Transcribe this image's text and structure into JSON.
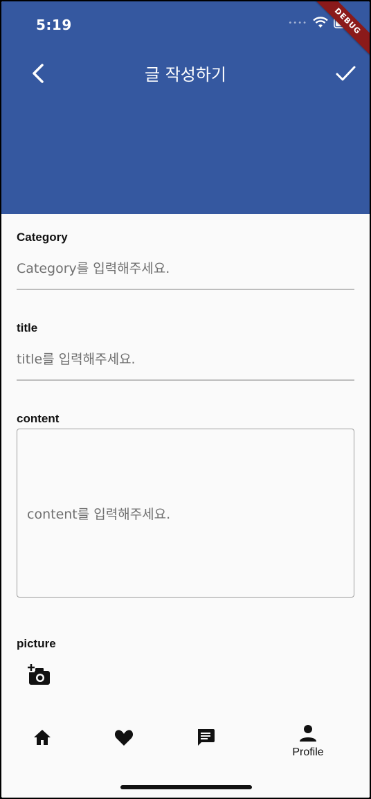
{
  "status_bar": {
    "time": "5:19",
    "debug_label": "DEBUG"
  },
  "app_bar": {
    "title": "글 작성하기",
    "back_icon": "chevron-left-icon",
    "confirm_icon": "check-icon"
  },
  "form": {
    "category": {
      "label": "Category",
      "placeholder": "Category를 입력해주세요."
    },
    "title": {
      "label": "title",
      "placeholder": "title를 입력해주세요."
    },
    "content": {
      "label": "content",
      "placeholder": "content를 입력해주세요."
    },
    "picture": {
      "label": "picture",
      "icon": "add-photo-icon"
    }
  },
  "bottom_nav": {
    "items": [
      {
        "icon": "home-icon",
        "label": ""
      },
      {
        "icon": "heart-icon",
        "label": ""
      },
      {
        "icon": "chat-icon",
        "label": ""
      },
      {
        "icon": "person-icon",
        "label": "Profile"
      }
    ]
  },
  "colors": {
    "app_bar": "#3558a0",
    "background": "#fafafa",
    "debug_banner": "#8b1a1a"
  }
}
